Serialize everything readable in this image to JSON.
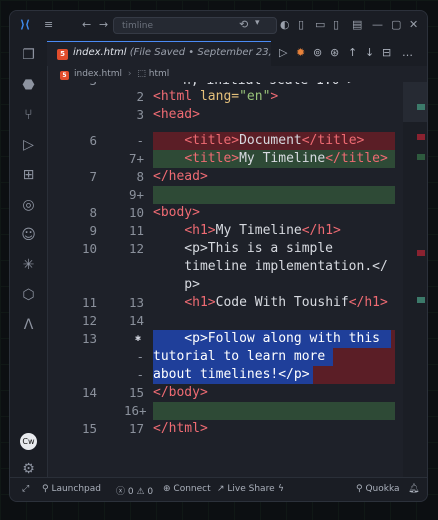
{
  "titlebar": {
    "search_placeholder": "timline"
  },
  "tab": {
    "filename": "index.html",
    "saved_note": "(File Saved • September 23, 2026 at 7"
  },
  "breadcrumb": {
    "file": "index.html",
    "symbol": "html"
  },
  "code_lines": {
    "l0": {
      "old": "5",
      "new": "",
      "text": "n, initial-scale=1.0\">"
    },
    "l1": {
      "old": "",
      "new": "2"
    },
    "l2": {
      "old": "",
      "new": "3"
    },
    "l3": {
      "old": "6",
      "new": "-"
    },
    "l4": {
      "old": "",
      "new": "7+"
    },
    "l5": {
      "old": "7",
      "new": "8"
    },
    "l6": {
      "old": "",
      "new": "9+"
    },
    "l7": {
      "old": "8",
      "new": "10"
    },
    "l8": {
      "old": "9",
      "new": "11"
    },
    "l9": {
      "old": "10",
      "new": "12",
      "text": "    <p>This is a simple"
    },
    "l10": {
      "text": "    timeline implementation.</"
    },
    "l11": {
      "text": "    p>"
    },
    "l12": {
      "old": "11",
      "new": "13"
    },
    "l13": {
      "old": "12",
      "new": "14"
    },
    "l14": {
      "old": "13",
      "new": "-",
      "text": "    <p>Follow along with this"
    },
    "l15": {
      "text": "tutorial to learn more"
    },
    "l16": {
      "new": "-",
      "text": "about timelines!</p>"
    },
    "l17": {
      "old": "14",
      "new": "15"
    },
    "l18": {
      "old": "",
      "new": "16+"
    },
    "l19": {
      "old": "15",
      "new": "17"
    }
  },
  "tokens": {
    "html_open": "<html",
    "lang_attr": " lang=",
    "lang_val": "\"en\"",
    "gt": ">",
    "head_open": "<head>",
    "title_open": "<title>",
    "title_close": "</title>",
    "doc_title": "Document",
    "new_title": "My Timeline",
    "head_close": "</head>",
    "body_open": "<body>",
    "h1_open": "<h1>",
    "h1_close": "</h1>",
    "h1_text1": "My Timeline",
    "h1_text2": "Code With Toushif",
    "body_close": "</body>",
    "html_close": "</html>"
  },
  "status": {
    "launchpad": "Launchpad",
    "errors": "0",
    "warnings": "0",
    "connect": "Connect",
    "live_share": "Live Share",
    "quokka": "Quokka"
  },
  "colors": {
    "deleted": "#5b1e26",
    "added": "#2e4a36",
    "selection": "#1f3f9a",
    "tag": "#ef6b73",
    "accent": "#4b8bf5"
  }
}
